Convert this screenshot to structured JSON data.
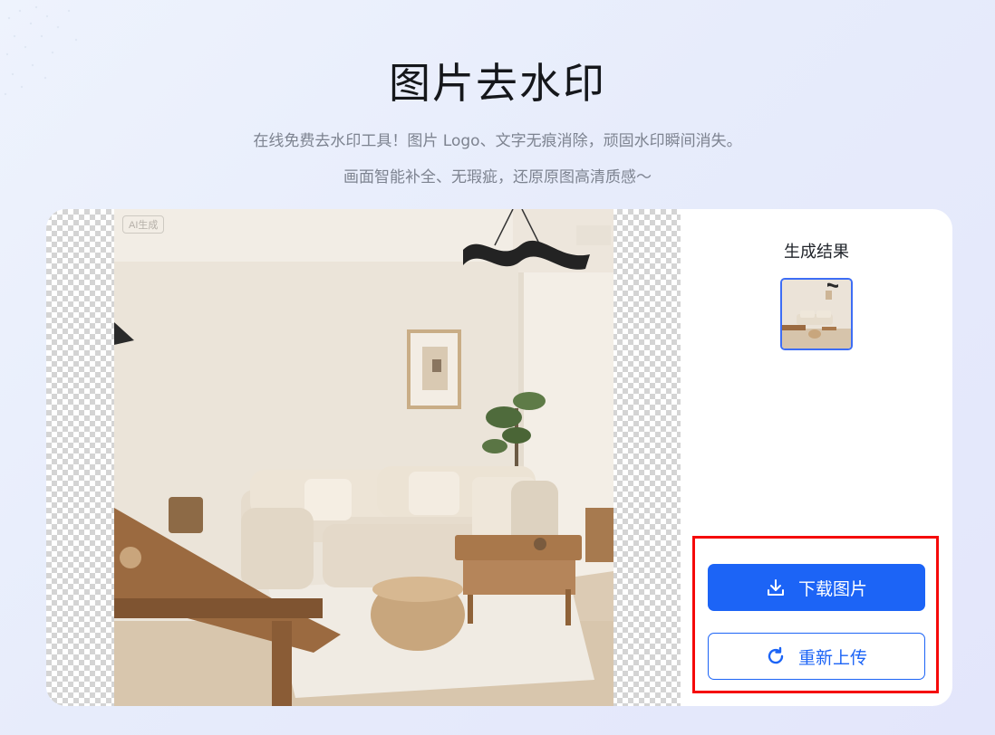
{
  "header": {
    "title": "图片去水印",
    "subtitle_line1": "在线免费去水印工具！图片 Logo、文字无痕消除，顽固水印瞬间消失。",
    "subtitle_line2": "画面智能补全、无瑕疵，还原原图高清质感～"
  },
  "preview": {
    "badge": "AI生成",
    "image_subject": "living-room-photo"
  },
  "result_panel": {
    "title": "生成结果",
    "thumbnail_subject": "living-room-thumbnail"
  },
  "actions": {
    "download_label": "下载图片",
    "download_icon": "download-icon",
    "reupload_label": "重新上传",
    "reupload_icon": "refresh-icon"
  },
  "colors": {
    "primary": "#1c64f6",
    "highlight": "#f50a0a"
  }
}
